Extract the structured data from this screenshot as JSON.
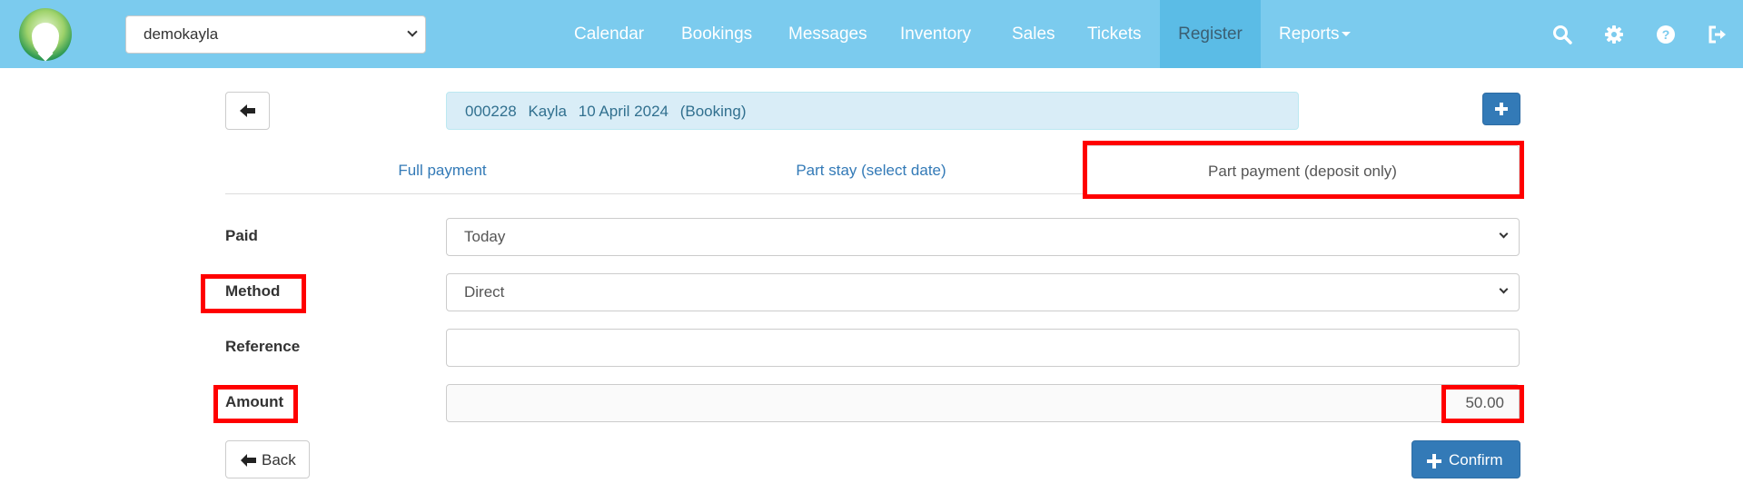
{
  "header": {
    "property_select": {
      "value": "demokayla"
    },
    "nav": [
      {
        "label": "Calendar"
      },
      {
        "label": "Bookings"
      },
      {
        "label": "Messages"
      },
      {
        "label": "Inventory"
      },
      {
        "label": "Sales"
      },
      {
        "label": "Tickets"
      },
      {
        "label": "Register",
        "active": true
      },
      {
        "label": "Reports",
        "dropdown": true
      }
    ],
    "icons": [
      "search-icon",
      "gear-icon",
      "help-icon",
      "logout-icon"
    ]
  },
  "booking": {
    "number": "000228",
    "guest": "Kayla",
    "date": "10 April 2024",
    "type": "(Booking)"
  },
  "tabs": [
    {
      "label": "Full payment"
    },
    {
      "label": "Part stay (select date)"
    },
    {
      "label": "Part payment (deposit only)",
      "active": true
    }
  ],
  "form": {
    "paid": {
      "label": "Paid",
      "value": "Today"
    },
    "method": {
      "label": "Method",
      "value": "Direct"
    },
    "reference": {
      "label": "Reference",
      "value": ""
    },
    "amount": {
      "label": "Amount",
      "value": "50.00"
    }
  },
  "buttons": {
    "back": "Back",
    "confirm": "Confirm"
  },
  "colors": {
    "navbar": "#7bcbee",
    "nav_active": "#5bbce6",
    "primary": "#337ab7",
    "banner_bg": "#d9edf7",
    "banner_text": "#31708f",
    "highlight": "#ff0000"
  }
}
